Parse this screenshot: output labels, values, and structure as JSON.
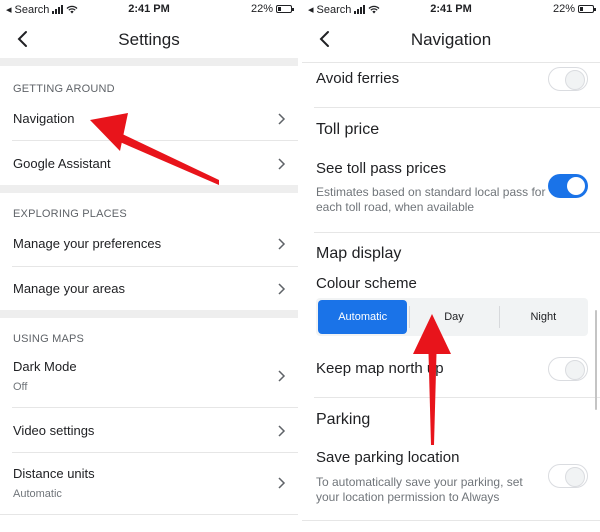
{
  "status_left": {
    "carrier": "Search",
    "time": "2:41 PM",
    "battery": "22%"
  },
  "status_right": {
    "carrier": "Search",
    "time": "2:41 PM",
    "battery": "22%"
  },
  "settings": {
    "title": "Settings",
    "getting_around": {
      "label": "GETTING AROUND",
      "items": [
        "Navigation",
        "Google Assistant"
      ]
    },
    "exploring_places": {
      "label": "EXPLORING PLACES",
      "items": [
        "Manage your preferences",
        "Manage your areas"
      ]
    },
    "using_maps": {
      "label": "USING MAPS",
      "dark_mode": {
        "label": "Dark Mode",
        "value": "Off"
      },
      "video_settings": "Video settings",
      "distance_units": {
        "label": "Distance units",
        "value": "Automatic"
      }
    }
  },
  "navigation": {
    "title": "Navigation",
    "avoid_ferries": {
      "label": "Avoid ferries",
      "enabled": false
    },
    "toll_price": {
      "heading": "Toll price",
      "see_toll_pass": {
        "label": "See toll pass prices",
        "description": "Estimates based on standard local pass for each toll road, when available",
        "enabled": true
      }
    },
    "map_display": {
      "heading": "Map display",
      "colour_scheme": {
        "label": "Colour scheme",
        "options": [
          "Automatic",
          "Day",
          "Night"
        ],
        "selected": "Automatic"
      },
      "keep_north_up": {
        "label": "Keep map north up",
        "enabled": false
      }
    },
    "parking": {
      "heading": "Parking",
      "save_parking": {
        "label": "Save parking location",
        "description": "To automatically save your parking, set your location permission to Always",
        "enabled": false
      }
    }
  },
  "colors": {
    "accent": "#1a73e8",
    "annotation_arrow": "#e8141b",
    "separator": "#eeeeee"
  }
}
